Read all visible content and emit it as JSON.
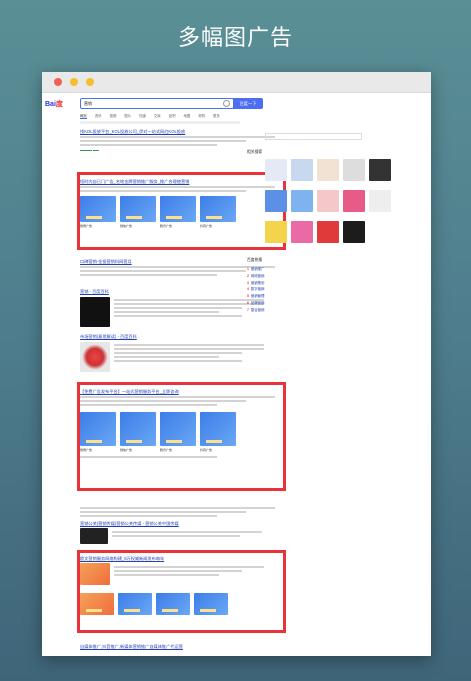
{
  "heading": "多幅图广告",
  "browser": {
    "logo_text": "Bai",
    "logo_paw": "度",
    "query": "营销",
    "search_button": "百度一下",
    "tabs": [
      "网页",
      "资讯",
      "视频",
      "图片",
      "知道",
      "文库",
      "贴吧",
      "地图",
      "采购",
      "更多"
    ]
  },
  "results": {
    "r1_title": "找KOL投放平台_KOL投放公司_伊对一站式网红KOL投放",
    "r2_title": "短时内自已门广告_名地金牌营销推广服务_推广合理使营销",
    "ad_captions": [
      "微博广告",
      "微信广告",
      "腾讯广告",
      "抖音广告"
    ],
    "r3_title": "口碑营销-金投营销科网营月",
    "r4_title": "营销 - 百度百科",
    "r5_title": "市场营销(意思解读) - 百度百科",
    "r6_title": "【免费广告发布平台】一站式营销服务平台_立即咨询",
    "r7_title": "营销公关(营销传媒)营销公关传媒 - 营销公关中国传媒",
    "r8_title": "欧文营销服务网络构建_8万权威新闻发布每年",
    "r9_title": "自媒体推广,抖音推广,新媒体营销推广自媒体推广代运营"
  },
  "sidebar": {
    "related_label": "相关搜索",
    "hot_label": "百度热搜",
    "hot_items": [
      "营销推广",
      "网络营销",
      "营销策划",
      "数字营销",
      "营销管理",
      "品牌营销",
      "整合营销"
    ]
  }
}
